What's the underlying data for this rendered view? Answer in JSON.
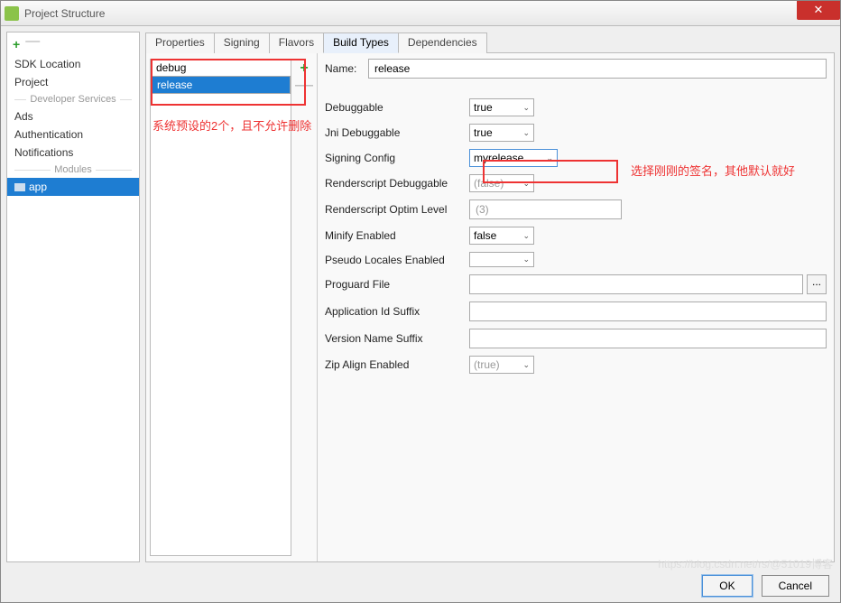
{
  "window": {
    "title": "Project Structure"
  },
  "sidebar": {
    "items": [
      "SDK Location",
      "Project"
    ],
    "serviceHead": "Developer Services",
    "services": [
      "Ads",
      "Authentication",
      "Notifications"
    ],
    "modulesHead": "Modules",
    "module": "app"
  },
  "tabs": [
    "Properties",
    "Signing",
    "Flavors",
    "Build Types",
    "Dependencies"
  ],
  "activeTab": 3,
  "buildTypes": [
    "debug",
    "release"
  ],
  "selectedBuildType": 1,
  "form": {
    "nameLabel": "Name:",
    "name": "release",
    "rows": [
      {
        "label": "Debuggable",
        "type": "select",
        "value": "true",
        "w": "small"
      },
      {
        "label": "Jni Debuggable",
        "type": "select",
        "value": "true",
        "w": "small"
      },
      {
        "label": "Signing Config",
        "type": "select",
        "value": "myrelease",
        "w": "med",
        "hl": true
      },
      {
        "label": "Renderscript Debuggable",
        "type": "select",
        "value": "(false)",
        "w": "small",
        "ro": true
      },
      {
        "label": "Renderscript Optim Level",
        "type": "text",
        "value": "(3)",
        "ro": true,
        "narrow": true
      },
      {
        "label": "Minify Enabled",
        "type": "select",
        "value": "false",
        "w": "small"
      },
      {
        "label": "Pseudo Locales Enabled",
        "type": "select",
        "value": "",
        "w": "small"
      },
      {
        "label": "Proguard File",
        "type": "text",
        "value": "",
        "dot": true
      },
      {
        "label": "Application Id Suffix",
        "type": "text",
        "value": ""
      },
      {
        "label": "Version Name Suffix",
        "type": "text",
        "value": ""
      },
      {
        "label": "Zip Align Enabled",
        "type": "select",
        "value": "(true)",
        "w": "small",
        "ro": true
      }
    ]
  },
  "anno1": "系统预设的2个，且不允许删除",
  "anno2": "选择刚刚的签名，其他默认就好",
  "buttons": {
    "ok": "OK",
    "cancel": "Cancel"
  },
  "watermark": "https://blog.csdn.net/rs/@51019博客"
}
